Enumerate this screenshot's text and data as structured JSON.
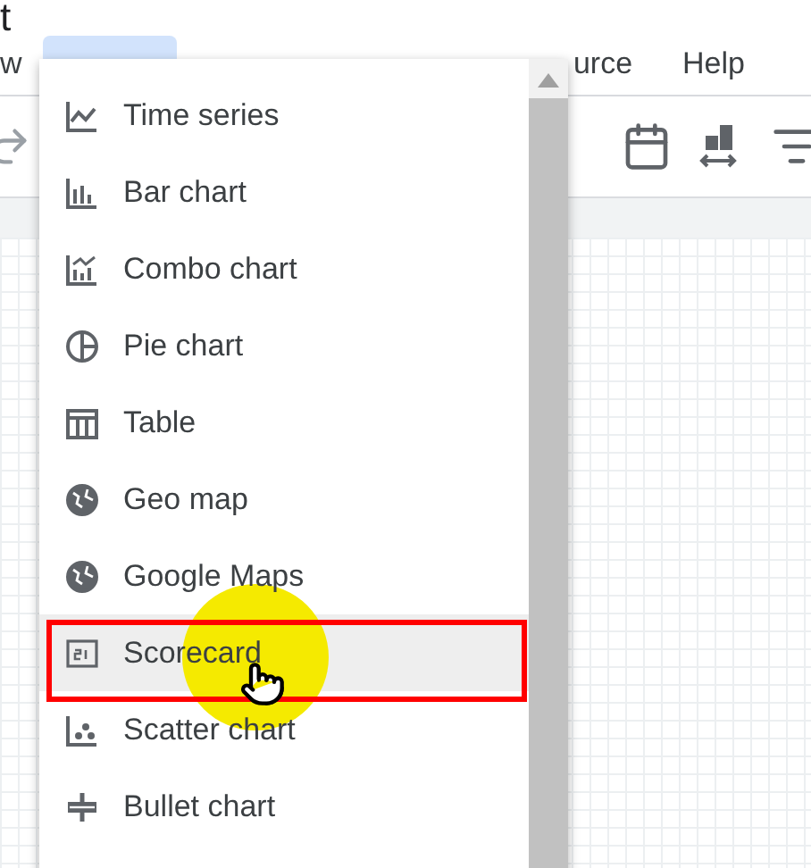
{
  "title": "t",
  "menu_bar": [
    {
      "label": "w"
    },
    {
      "label": "urce"
    },
    {
      "label": "Help"
    }
  ],
  "insert_menu": {
    "items": [
      {
        "label": "Time series",
        "selected": false
      },
      {
        "label": "Bar chart",
        "selected": false
      },
      {
        "label": "Combo chart",
        "selected": false
      },
      {
        "label": "Pie chart",
        "selected": false
      },
      {
        "label": "Table",
        "selected": false
      },
      {
        "label": "Geo map",
        "selected": false
      },
      {
        "label": "Google Maps",
        "selected": false
      },
      {
        "label": "Scorecard",
        "selected": true
      },
      {
        "label": "Scatter chart",
        "selected": false
      },
      {
        "label": "Bullet chart",
        "selected": false
      }
    ]
  }
}
